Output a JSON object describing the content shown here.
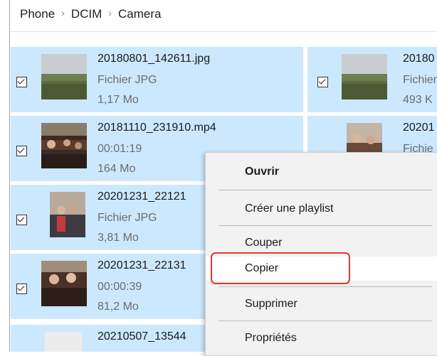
{
  "breadcrumb": [
    "Phone",
    "DCIM",
    "Camera"
  ],
  "files": [
    {
      "name": "20180801_142611.jpg",
      "line2": "Fichier JPG",
      "line3": "1,17 Mo"
    },
    {
      "name": "20180",
      "line2": "Fichier",
      "line3": "493 K"
    },
    {
      "name": "20181110_231910.mp4",
      "line2": "00:01:19",
      "line3": "164 Mo"
    },
    {
      "name": "20201",
      "line2": "Fichie",
      "line3": ""
    },
    {
      "name": "20201231_22121",
      "line2": "Fichier JPG",
      "line3": "3,81 Mo"
    },
    {
      "name": "20201231_22131",
      "line2": "00:00:39",
      "line3": "81,2 Mo"
    },
    {
      "name": "20210507_13544",
      "line2": "",
      "line3": ""
    }
  ],
  "menu": {
    "open": "Ouvrir",
    "playlist": "Créer une playlist",
    "cut": "Couper",
    "copy": "Copier",
    "delete": "Supprimer",
    "properties": "Propriétés"
  },
  "colors": {
    "selection": "#cce8ff",
    "highlight": "#e0392b",
    "menu_bg": "#f2f2f2"
  }
}
